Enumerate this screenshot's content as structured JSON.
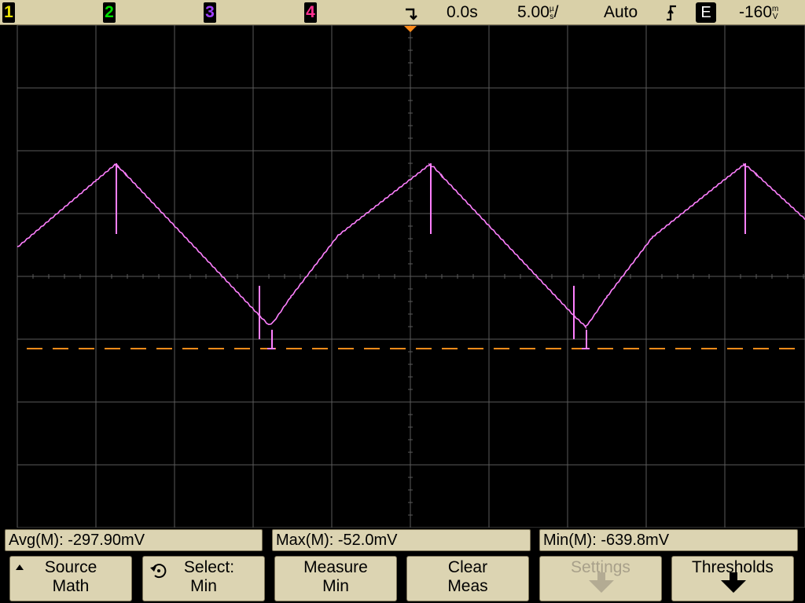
{
  "topbar": {
    "channels": [
      {
        "label": "1",
        "color": "#e8e000"
      },
      {
        "label": "2",
        "color": "#00e000"
      },
      {
        "label": "3",
        "color": "#a040ff"
      },
      {
        "label": "4",
        "color": "#ff3090"
      }
    ],
    "trigger_delay": "0.0s",
    "timebase_value": "5.00",
    "timebase_unit_top": "µ",
    "timebase_unit_bottom": "s",
    "timebase_suffix": "/",
    "trigger_mode": "Auto",
    "trigger_slope_icon": "rising-edge-icon",
    "trigger_source": "E",
    "trigger_level_value": "-160",
    "trigger_level_unit_top": "m",
    "trigger_level_unit_bottom": "V"
  },
  "colors": {
    "waveform": "#ff80ff",
    "trigger_level_line": "#ff8c1a",
    "trigger_marker": "#ff8c1a",
    "grid": "#5a5a5a"
  },
  "measurements": {
    "avg": "Avg(M):  -297.90mV",
    "max": "Max(M):  -52.0mV",
    "min": "Min(M):  -639.8mV"
  },
  "softkeys": {
    "source": {
      "l1": "Source",
      "l2": "Math",
      "icon": "up-arrow-icon"
    },
    "select": {
      "l1": "Select:",
      "l2": "Min",
      "icon": "rotate-knob-icon"
    },
    "measure": {
      "l1": "Measure",
      "l2": "Min"
    },
    "clear": {
      "l1": "Clear",
      "l2": "Meas"
    },
    "settings": {
      "l1": "Settings",
      "icon": "arrow-down-icon"
    },
    "thresholds": {
      "l1": "Thresholds",
      "icon": "arrow-down-icon"
    }
  }
}
